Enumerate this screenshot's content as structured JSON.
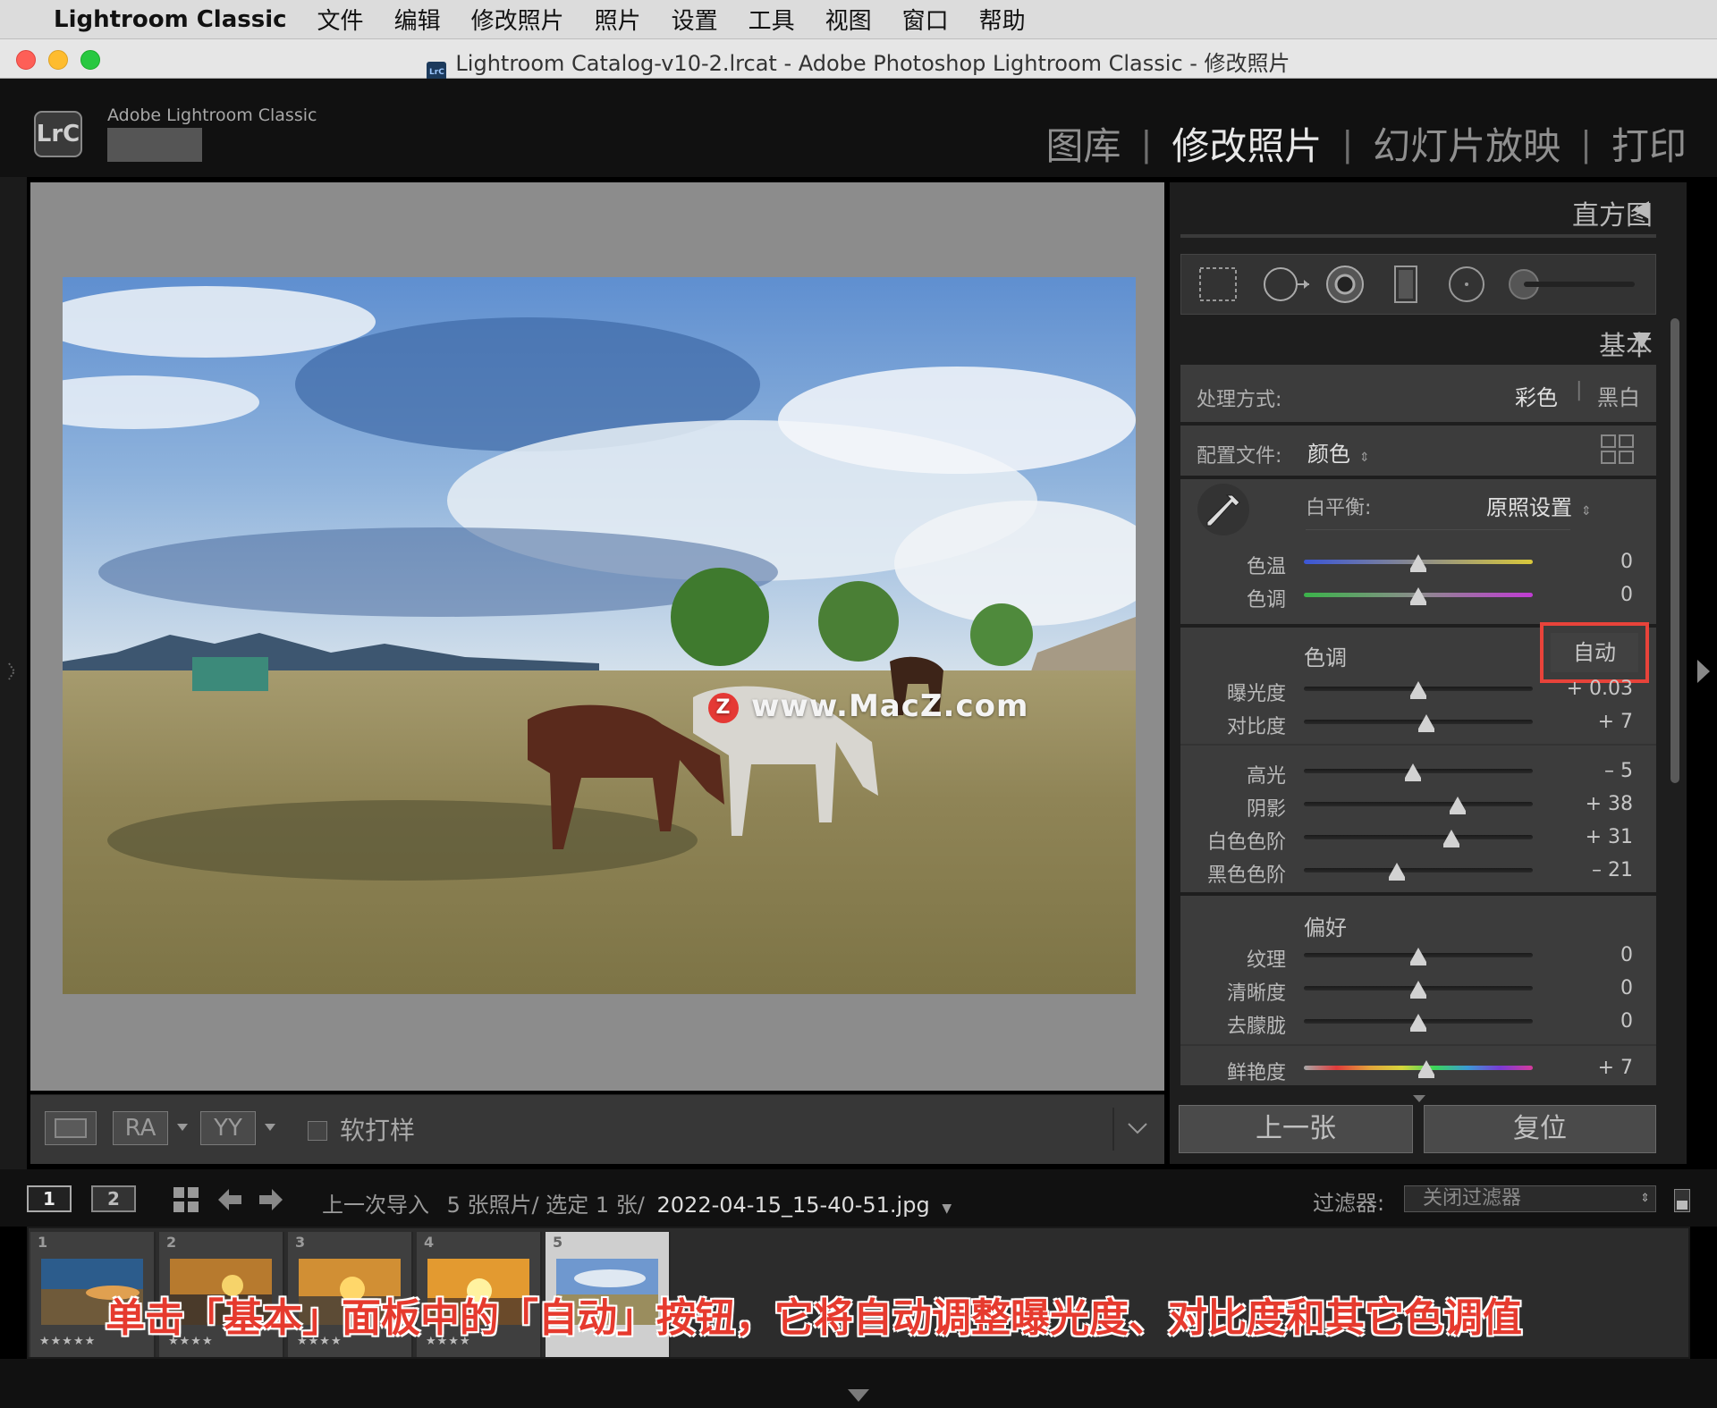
{
  "menubar": {
    "app_name": "Lightroom Classic",
    "items": [
      "文件",
      "编辑",
      "修改照片",
      "照片",
      "设置",
      "工具",
      "视图",
      "窗口",
      "帮助"
    ]
  },
  "window": {
    "title": "Lightroom Catalog-v10-2.lrcat - Adobe Photoshop Lightroom Classic - 修改照片",
    "icon_text": "LrC"
  },
  "header": {
    "logo": "LrC",
    "app_name": "Adobe Lightroom Classic",
    "modules": [
      {
        "label": "图库",
        "active": false
      },
      {
        "label": "修改照片",
        "active": true
      },
      {
        "label": "幻灯片放映",
        "active": false
      },
      {
        "label": "打印",
        "active": false
      }
    ]
  },
  "watermark": "www.MacZ.com",
  "watermark_badge": "Z",
  "toolbar": {
    "softproof_label": "软打样",
    "ra_label": "RA",
    "yy_label": "YY"
  },
  "right_panel": {
    "histogram_title": "直方图",
    "basic_title": "基本",
    "treatment_label": "处理方式:",
    "treatment_color": "彩色",
    "treatment_bw": "黑白",
    "profile_label": "配置文件:",
    "profile_value": "颜色",
    "wb_label": "白平衡:",
    "wb_value": "原照设置",
    "tone_title": "色调",
    "auto_button": "自动",
    "presence_title": "偏好",
    "wb_sliders": [
      {
        "label": "色温",
        "value": "0",
        "pos": 0.5
      },
      {
        "label": "色调",
        "value": "0",
        "pos": 0.5
      }
    ],
    "tone_sliders_a": [
      {
        "label": "曝光度",
        "value": "+ 0.03",
        "pos": 0.5
      },
      {
        "label": "对比度",
        "value": "+ 7",
        "pos": 0.535
      }
    ],
    "tone_sliders_b": [
      {
        "label": "高光",
        "value": "– 5",
        "pos": 0.475
      },
      {
        "label": "阴影",
        "value": "+ 38",
        "pos": 0.67
      },
      {
        "label": "白色色阶",
        "value": "+ 31",
        "pos": 0.645
      },
      {
        "label": "黑色色阶",
        "value": "– 21",
        "pos": 0.405
      }
    ],
    "presence_sliders": [
      {
        "label": "纹理",
        "value": "0",
        "pos": 0.5
      },
      {
        "label": "清晰度",
        "value": "0",
        "pos": 0.5
      },
      {
        "label": "去朦胧",
        "value": "0",
        "pos": 0.5
      }
    ],
    "vibrance": {
      "label": "鲜艳度",
      "value": "+ 7",
      "pos": 0.535
    },
    "prev_button": "上一张",
    "reset_button": "复位"
  },
  "filmstrip_nav": {
    "view1": "1",
    "view2": "2",
    "source": "上一次导入",
    "count": "5 张照片/ 选定 1 张/",
    "filename": "2022-04-15_15-40-51.jpg",
    "filter_label": "过滤器:",
    "filter_value": "关闭过滤器"
  },
  "filmstrip": [
    {
      "n": "1",
      "stars": "★★★★★"
    },
    {
      "n": "2",
      "stars": "★★★★"
    },
    {
      "n": "3",
      "stars": "★★★★"
    },
    {
      "n": "4",
      "stars": "★★★★"
    },
    {
      "n": "5",
      "stars": ""
    }
  ],
  "caption": "单击「基本」面板中的「自动」按钮，它将自动调整曝光度、对比度和其它色调值",
  "colors": {
    "accent_red": "#e63a2e",
    "panel_bg": "#3c3c3c",
    "highlight_box": "#e8433a"
  }
}
